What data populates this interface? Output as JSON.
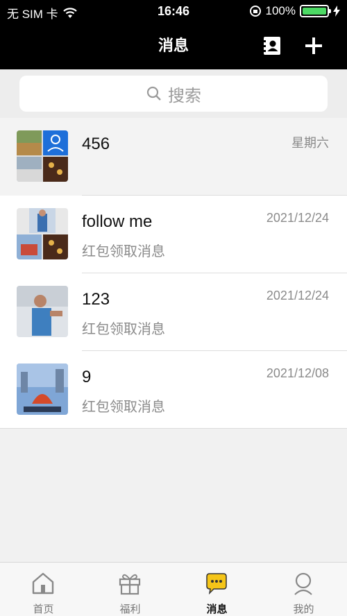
{
  "status_bar": {
    "carrier": "无 SIM 卡",
    "time": "16:46",
    "battery": "100%"
  },
  "nav": {
    "title": "消息"
  },
  "search": {
    "placeholder": "搜索"
  },
  "conversations": [
    {
      "name": "456",
      "preview": "",
      "time": "星期六"
    },
    {
      "name": "follow me",
      "preview": "红包领取消息",
      "time": "2021/12/24"
    },
    {
      "name": "123",
      "preview": "红包领取消息",
      "time": "2021/12/24"
    },
    {
      "name": "9",
      "preview": "红包领取消息",
      "time": "2021/12/08"
    }
  ],
  "tabs": [
    {
      "label": "首页",
      "icon": "home-icon"
    },
    {
      "label": "福利",
      "icon": "gift-icon"
    },
    {
      "label": "消息",
      "icon": "chat-bubble-icon",
      "active": true
    },
    {
      "label": "我的",
      "icon": "profile-icon"
    }
  ],
  "colors": {
    "nav_bg": "#000000",
    "battery_green": "#4cd964",
    "chat_tab_accent": "#f5c518"
  }
}
